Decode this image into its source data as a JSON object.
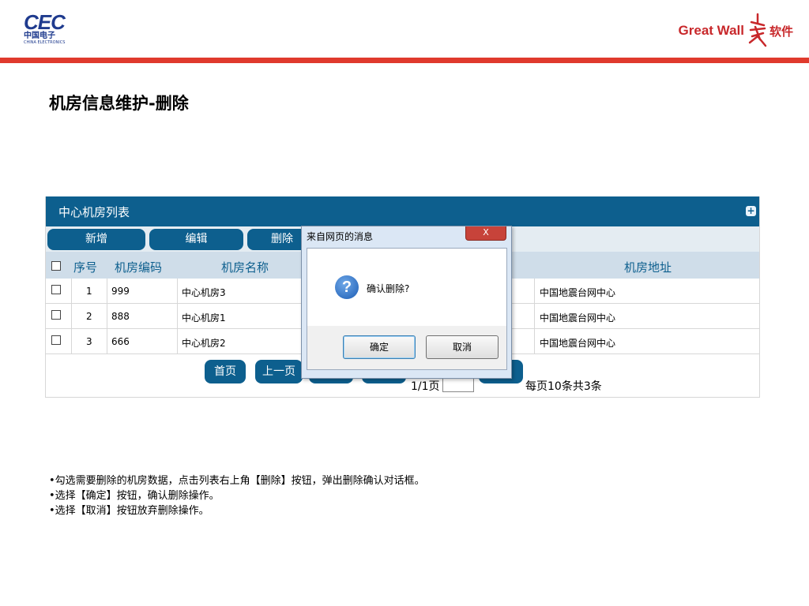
{
  "header": {
    "cec_logo": "CEC",
    "cec_cn": "中国电子",
    "cec_en": "CHINA ELECTRONICS",
    "gw_logo": "Great Wall",
    "gw_cn": "软件"
  },
  "page_title": "机房信息维护-删除",
  "panel": {
    "title": "中心机房列表",
    "plus": "+",
    "toolbar": {
      "add": "新增",
      "edit": "编辑",
      "delete": "删除"
    },
    "columns": {
      "no": "序号",
      "code": "机房编码",
      "name": "机房名称",
      "address": "机房地址"
    },
    "rows": [
      {
        "no": "1",
        "code": "999",
        "name": "中心机房3",
        "address": "中国地震台网中心"
      },
      {
        "no": "2",
        "code": "888",
        "name": "中心机房1",
        "address": "中国地震台网中心"
      },
      {
        "no": "3",
        "code": "666",
        "name": "中心机房2",
        "address": "中国地震台网中心"
      }
    ],
    "pager": {
      "first": "首页",
      "prev": "上一页",
      "page_info": "1/1页",
      "summary": "每页10条共3条"
    }
  },
  "dialog": {
    "title": "来自网页的消息",
    "close": "X",
    "message": "确认删除?",
    "ok": "确定",
    "cancel": "取消"
  },
  "notes": [
    "•勾选需要删除的机房数据，点击列表右上角【删除】按钮，弹出删除确认对话框。",
    "•选择【确定】按钮，确认删除操作。",
    "•选择【取消】按钮放弃删除操作。"
  ],
  "colors": {
    "header_blue": "#0d5f8e",
    "accent_red": "#e03a2d"
  }
}
